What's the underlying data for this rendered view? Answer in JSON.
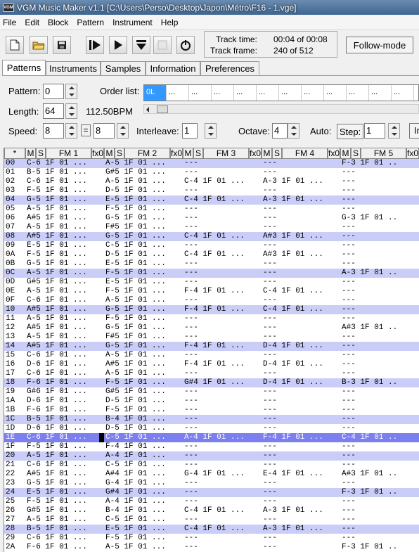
{
  "window": {
    "title": "VGM Music Maker v1.1 [C:\\Users\\Perso\\Desktop\\Japon\\Métro\\F16 - 1.vge]",
    "app_icon_text": "VGM"
  },
  "menu": [
    "File",
    "Edit",
    "Block",
    "Pattern",
    "Instrument",
    "Help"
  ],
  "toolbar": {
    "buttons": [
      "new-file-icon",
      "open-folder-icon",
      "save-icon",
      "play-pattern-icon",
      "play-icon",
      "play-from-cursor-icon",
      "stop-icon",
      "record-icon"
    ],
    "track_time_label": "Track time:",
    "track_time_value": "00:04 of 00:08",
    "track_frame_label": "Track frame:",
    "track_frame_value": "240 of 512",
    "follow_mode": "Follow-mode"
  },
  "tabs": [
    "Patterns",
    "Instruments",
    "Samples",
    "Information",
    "Preferences"
  ],
  "pattern_panel": {
    "pattern_label": "Pattern:",
    "pattern_value": "0",
    "length_label": "Length:",
    "length_value": "64",
    "bpm": "112.50BPM",
    "order_list_label": "Order list:",
    "order_list": [
      "0L",
      "...",
      "...",
      "...",
      "...",
      "...",
      "...",
      "...",
      "...",
      "...",
      "...",
      "..."
    ],
    "speed_label": "Speed:",
    "speed_value_1": "8",
    "speed_eq": "=",
    "speed_value_2": "8",
    "interleave_label": "Interleave:",
    "interleave_value": "1",
    "octave_label": "Octave:",
    "octave_value": "4",
    "auto_label": "Auto:",
    "step_label": "Step:",
    "step_value": "1",
    "cut_off_label": "In"
  },
  "grid": {
    "header": [
      "*",
      "M",
      "S",
      "FM 1",
      "fx0",
      "M",
      "S",
      "FM 2",
      "fx0",
      "M",
      "S",
      "FM 3",
      "fx0",
      "M",
      "S",
      "FM 4",
      "fx0",
      "M",
      "S",
      "FM 5",
      "fx0"
    ],
    "highlight_rows": [
      0,
      4,
      8,
      12,
      16,
      20,
      24,
      28,
      32,
      36,
      40
    ],
    "current_row": 30,
    "rows": [
      [
        "00",
        "C-6 1F 01 ...",
        "A-5 1F 01 ...",
        "---         ",
        "---         ",
        "F-3 1F 01 .."
      ],
      [
        "01",
        "B-5 1F 01 ...",
        "G#5 1F 01 ...",
        "---         ",
        "---         ",
        "---         "
      ],
      [
        "02",
        "C-6 1F 01 ...",
        "A-5 1F 01 ...",
        "C-4 1F 01 ...",
        "A-3 1F 01 ...",
        "---         "
      ],
      [
        "03",
        "F-5 1F 01 ...",
        "D-5 1F 01 ...",
        "---         ",
        "---         ",
        "---         "
      ],
      [
        "04",
        "G-5 1F 01 ...",
        "E-5 1F 01 ...",
        "C-4 1F 01 ...",
        "A-3 1F 01 ...",
        "---         "
      ],
      [
        "05",
        "A-5 1F 01 ...",
        "F-5 1F 01 ...",
        "---         ",
        "---         ",
        "---         "
      ],
      [
        "06",
        "A#5 1F 01 ...",
        "G-5 1F 01 ...",
        "---         ",
        "---         ",
        "G-3 1F 01 .."
      ],
      [
        "07",
        "A-5 1F 01 ...",
        "F#5 1F 01 ...",
        "---         ",
        "---         ",
        "---         "
      ],
      [
        "08",
        "A#5 1F 01 ...",
        "G-5 1F 01 ...",
        "C-4 1F 01 ...",
        "A#3 1F 01 ...",
        "---         "
      ],
      [
        "09",
        "E-5 1F 01 ...",
        "C-5 1F 01 ...",
        "---         ",
        "---         ",
        "---         "
      ],
      [
        "0A",
        "F-5 1F 01 ...",
        "D-5 1F 01 ...",
        "C-4 1F 01 ...",
        "A#3 1F 01 ...",
        "---         "
      ],
      [
        "0B",
        "G-5 1F 01 ...",
        "E-5 1F 01 ...",
        "---         ",
        "---         ",
        "---         "
      ],
      [
        "0C",
        "A-5 1F 01 ...",
        "F-5 1F 01 ...",
        "---         ",
        "---         ",
        "A-3 1F 01 .."
      ],
      [
        "0D",
        "G#5 1F 01 ...",
        "E-5 1F 01 ...",
        "---         ",
        "---         ",
        "---         "
      ],
      [
        "0E",
        "A-5 1F 01 ...",
        "F-5 1F 01 ...",
        "F-4 1F 01 ...",
        "C-4 1F 01 ...",
        "---         "
      ],
      [
        "0F",
        "C-6 1F 01 ...",
        "A-5 1F 01 ...",
        "---         ",
        "---         ",
        "---         "
      ],
      [
        "10",
        "A#5 1F 01 ...",
        "G-5 1F 01 ...",
        "F-4 1F 01 ...",
        "C-4 1F 01 ...",
        "---         "
      ],
      [
        "11",
        "A-5 1F 01 ...",
        "F-5 1F 01 ...",
        "---         ",
        "---         ",
        "---         "
      ],
      [
        "12",
        "A#5 1F 01 ...",
        "G-5 1F 01 ...",
        "---         ",
        "---         ",
        "A#3 1F 01 .."
      ],
      [
        "13",
        "A-5 1F 01 ...",
        "F#5 1F 01 ...",
        "---         ",
        "---         ",
        "---         "
      ],
      [
        "14",
        "A#5 1F 01 ...",
        "G-5 1F 01 ...",
        "F-4 1F 01 ...",
        "D-4 1F 01 ...",
        "---         "
      ],
      [
        "15",
        "C-6 1F 01 ...",
        "A-5 1F 01 ...",
        "---         ",
        "---         ",
        "---         "
      ],
      [
        "16",
        "D-6 1F 01 ...",
        "A#5 1F 01 ...",
        "F-4 1F 01 ...",
        "D-4 1F 01 ...",
        "---         "
      ],
      [
        "17",
        "C-6 1F 01 ...",
        "A-5 1F 01 ...",
        "---         ",
        "---         ",
        "---         "
      ],
      [
        "18",
        "F-6 1F 01 ...",
        "F-5 1F 01 ...",
        "G#4 1F 01 ...",
        "D-4 1F 01 ...",
        "B-3 1F 01 .."
      ],
      [
        "19",
        "G#6 1F 01 ...",
        "G#5 1F 01 ...",
        "---         ",
        "---         ",
        "---         "
      ],
      [
        "1A",
        "D-6 1F 01 ...",
        "D-5 1F 01 ...",
        "---         ",
        "---         ",
        "---         "
      ],
      [
        "1B",
        "F-6 1F 01 ...",
        "F-5 1F 01 ...",
        "---         ",
        "---         ",
        "---         "
      ],
      [
        "1C",
        "B-5 1F 01 ...",
        "B-4 1F 01 ...",
        "---         ",
        "---         ",
        "---         "
      ],
      [
        "1D",
        "D-6 1F 01 ...",
        "D-5 1F 01 ...",
        "---         ",
        "---         ",
        "---         "
      ],
      [
        "1E",
        "C-6 1F 01 ...",
        "C-5 1F 01 ...",
        "A-4 1F 01 ...",
        "F-4 1F 01 ...",
        "C-4 1F 01 .."
      ],
      [
        "1F",
        "F-5 1F 01 ...",
        "F-4 1F 01 ...",
        "---         ",
        "---         ",
        "---         "
      ],
      [
        "20",
        "A-5 1F 01 ...",
        "A-4 1F 01 ...",
        "---         ",
        "---         ",
        "---         "
      ],
      [
        "21",
        "C-6 1F 01 ...",
        "C-5 1F 01 ...",
        "---         ",
        "---         ",
        "---         "
      ],
      [
        "22",
        "A#5 1F 01 ...",
        "A#4 1F 01 ...",
        "G-4 1F 01 ...",
        "E-4 1F 01 ...",
        "A#3 1F 01 .."
      ],
      [
        "23",
        "G-5 1F 01 ...",
        "G-4 1F 01 ...",
        "---         ",
        "---         ",
        "---         "
      ],
      [
        "24",
        "E-5 1F 01 ...",
        "G#4 1F 01 ...",
        "---         ",
        "---         ",
        "F-3 1F 01 .."
      ],
      [
        "25",
        "F-5 1F 01 ...",
        "A-4 1F 01 ...",
        "---         ",
        "---         ",
        "---         "
      ],
      [
        "26",
        "G#5 1F 01 ...",
        "B-4 1F 01 ...",
        "C-4 1F 01 ...",
        "A-3 1F 01 ...",
        "---         "
      ],
      [
        "27",
        "A-5 1F 01 ...",
        "C-5 1F 01 ...",
        "---         ",
        "---         ",
        "---         "
      ],
      [
        "28",
        "B-5 1F 01 ...",
        "E-5 1F 01 ...",
        "C-4 1F 01 ...",
        "A-3 1F 01 ...",
        "---         "
      ],
      [
        "29",
        "C-6 1F 01 ...",
        "F-5 1F 01 ...",
        "---         ",
        "---         ",
        "---         "
      ],
      [
        "2A",
        "F-6 1F 01 ...",
        "A-5 1F 01 ...",
        "---         ",
        "---         ",
        "F-3 1F 01 .."
      ]
    ]
  },
  "colors": {
    "highlight": "#c9cdf8",
    "current": "#7b7ff0",
    "selection": "#3399ff"
  }
}
